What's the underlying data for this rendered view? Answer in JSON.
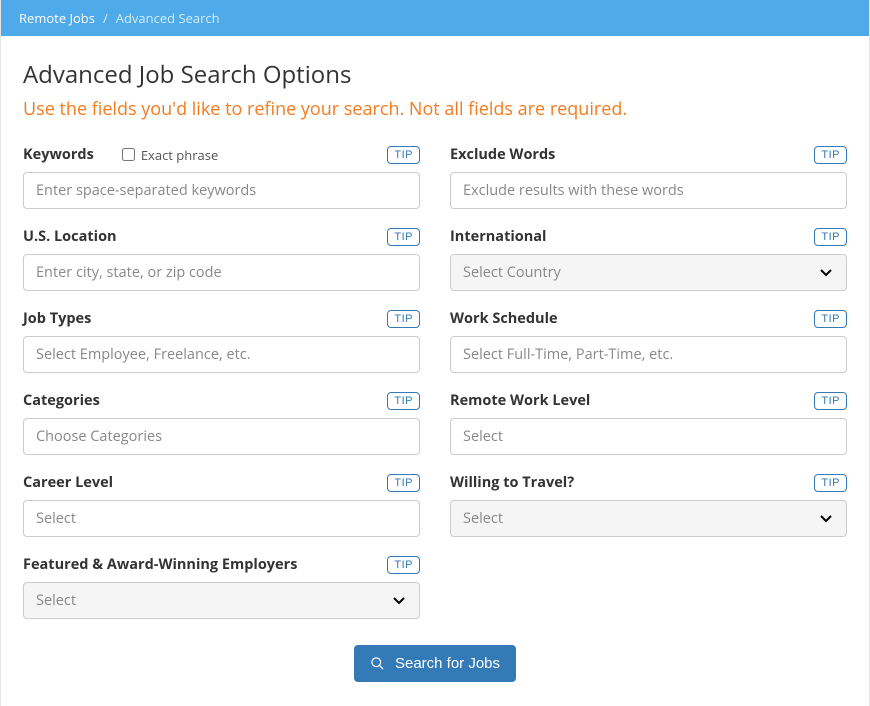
{
  "breadcrumb": {
    "root": "Remote Jobs",
    "current": "Advanced Search"
  },
  "heading": "Advanced Job Search Options",
  "subtitle": "Use the fields you'd like to refine your search. Not all fields are required.",
  "tip_label": "TIP",
  "fields": {
    "keywords": {
      "label": "Keywords",
      "placeholder": "Enter space-separated keywords",
      "exact_phrase_label": "Exact phrase"
    },
    "exclude": {
      "label": "Exclude Words",
      "placeholder": "Exclude results with these words"
    },
    "location": {
      "label": "U.S. Location",
      "placeholder": "Enter city, state, or zip code"
    },
    "international": {
      "label": "International",
      "placeholder": "Select Country"
    },
    "job_types": {
      "label": "Job Types",
      "placeholder": "Select Employee, Freelance, etc."
    },
    "schedule": {
      "label": "Work Schedule",
      "placeholder": "Select Full-Time, Part-Time, etc."
    },
    "categories": {
      "label": "Categories",
      "placeholder": "Choose Categories"
    },
    "remote_level": {
      "label": "Remote Work Level",
      "placeholder": "Select"
    },
    "career_level": {
      "label": "Career Level",
      "placeholder": "Select"
    },
    "travel": {
      "label": "Willing to Travel?",
      "placeholder": "Select"
    },
    "featured": {
      "label": "Featured & Award-Winning Employers",
      "placeholder": "Select"
    }
  },
  "submit_label": "Search for Jobs"
}
